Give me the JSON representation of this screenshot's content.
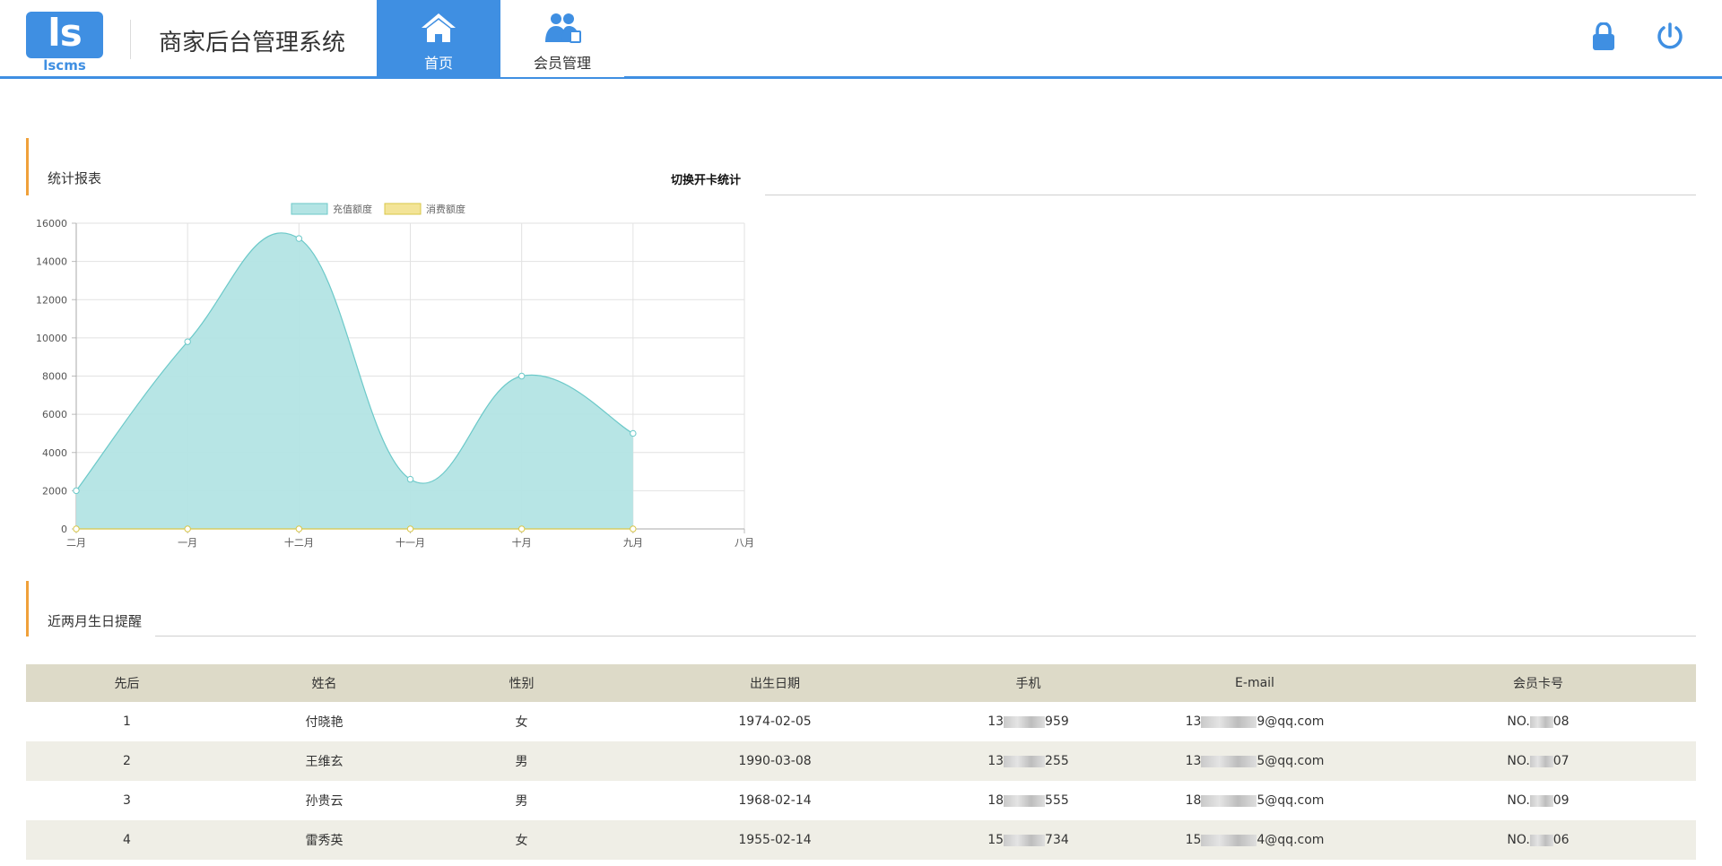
{
  "header": {
    "logo_text": "ls",
    "logo_sub": "lscms",
    "system_title": "商家后台管理系统",
    "nav": [
      {
        "label": "首页",
        "icon": "home-icon",
        "active": true
      },
      {
        "label": "会员管理",
        "icon": "members-icon",
        "active": false
      }
    ],
    "actions": [
      {
        "icon": "lock-icon"
      },
      {
        "icon": "power-icon"
      }
    ],
    "accent_color": "#3f8fe2"
  },
  "stats": {
    "section_title": "统计报表",
    "switch_label": "切换开卡统计"
  },
  "chart_data": {
    "type": "area",
    "categories": [
      "二月",
      "一月",
      "十二月",
      "十一月",
      "十月",
      "九月",
      "八月"
    ],
    "series": [
      {
        "name": "充值额度",
        "values": [
          2000,
          9800,
          15200,
          2600,
          8000,
          5000,
          null
        ],
        "color": "#b3e4e4",
        "stroke": "#6cc9c9"
      },
      {
        "name": "消费额度",
        "values": [
          0,
          0,
          0,
          0,
          0,
          0,
          null
        ],
        "color": "#f3e497",
        "stroke": "#d8c74a"
      }
    ],
    "yticks": [
      0,
      2000,
      4000,
      6000,
      8000,
      10000,
      12000,
      14000,
      16000
    ],
    "ylim": [
      0,
      16000
    ],
    "grid": true,
    "legend": "top-center"
  },
  "birthday": {
    "section_title": "近两月生日提醒",
    "columns": [
      "先后",
      "姓名",
      "性别",
      "出生日期",
      "手机",
      "E-mail",
      "会员卡号"
    ],
    "rows": [
      {
        "order": "1",
        "name": "付晓艳",
        "gender": "女",
        "birth": "1974-02-05",
        "phone_pre": "13",
        "phone_post": "959",
        "email_pre": "13",
        "email_post": "9@qq.com",
        "card_pre": "NO.",
        "card_post": "08"
      },
      {
        "order": "2",
        "name": "王维玄",
        "gender": "男",
        "birth": "1990-03-08",
        "phone_pre": "13",
        "phone_post": "255",
        "email_pre": "13",
        "email_post": "5@qq.com",
        "card_pre": "NO.",
        "card_post": "07"
      },
      {
        "order": "3",
        "name": "孙贵云",
        "gender": "男",
        "birth": "1968-02-14",
        "phone_pre": "18",
        "phone_post": "555",
        "email_pre": "18",
        "email_post": "5@qq.com",
        "card_pre": "NO.",
        "card_post": "09"
      },
      {
        "order": "4",
        "name": "雷秀英",
        "gender": "女",
        "birth": "1955-02-14",
        "phone_pre": "15",
        "phone_post": "734",
        "email_pre": "15",
        "email_post": "4@qq.com",
        "card_pre": "NO.",
        "card_post": "06"
      }
    ]
  }
}
